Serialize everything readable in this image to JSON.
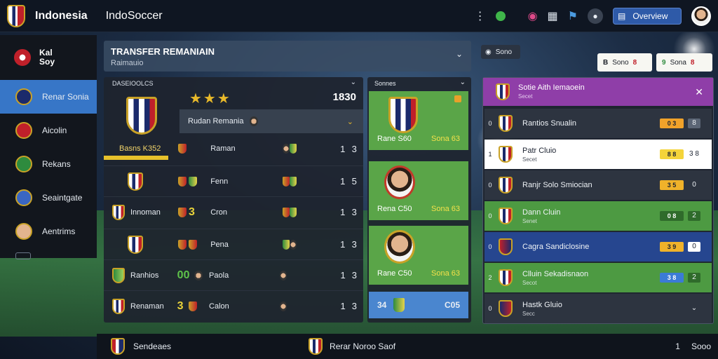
{
  "header": {
    "title": "Indonesia",
    "subtitle": "IndoSoccer",
    "button_label": "Overview"
  },
  "sidebar": {
    "head_label_1": "Kal",
    "head_label_2": "Soy",
    "items": [
      {
        "label": "Renar Sonia"
      },
      {
        "label": "Aicolin"
      },
      {
        "label": "Rekans"
      },
      {
        "label": "Seaintgate"
      },
      {
        "label": "Aentrims"
      }
    ]
  },
  "transfer": {
    "title": "TRANSFER REMANIAIN",
    "subtitle": "Raimauio"
  },
  "list_panel": {
    "header": "DASEIOOLCS",
    "stars": "★★★",
    "top_score": "1830",
    "club_name": "Basns K352",
    "highlight": {
      "name": "Rudan Remania"
    },
    "rows": [
      {
        "icons_lead": "",
        "name": "Raman",
        "n1": "1",
        "n2": "3"
      },
      {
        "icons_lead": "",
        "name": "Fenn",
        "n1": "1",
        "n2": "5"
      },
      {
        "lead": "Innoman",
        "hl": "3",
        "name": "Cron",
        "n1": "1",
        "n2": "3"
      },
      {
        "lead": "",
        "name": "Pena",
        "n1": "1",
        "n2": "3"
      },
      {
        "lead": "Ranhios",
        "hl": "00",
        "name": "Paola",
        "n1": "1",
        "n2": "3"
      },
      {
        "lead": "Renaman",
        "hl": "3",
        "name": "Calon",
        "n1": "1",
        "n2": "3"
      }
    ]
  },
  "cards": {
    "header": "Sonnes",
    "items": [
      {
        "left": "Rane S60",
        "right": "Sona 63"
      },
      {
        "left": "Rena C50",
        "right": "Sona 63"
      },
      {
        "left": "Rane C50",
        "right": "Sona 63"
      }
    ],
    "blue": {
      "left": "34",
      "right": "C05"
    }
  },
  "right_panel": {
    "toggle_label": "Sono",
    "btn1": {
      "icon": "B",
      "label": "Sono",
      "value": "8"
    },
    "btn2": {
      "icon": "9",
      "label": "Sona",
      "value": "8"
    },
    "header": {
      "title": "Sotie Aith Iemaoein",
      "sub": "Secet"
    },
    "rows": [
      {
        "idx": "0",
        "title": "Rantios Snualin",
        "sub": "",
        "sc": "0 3",
        "sc2": "8",
        "style": "dark",
        "scColor": "#f0a22a"
      },
      {
        "idx": "1",
        "title": "Patr Cluio",
        "sub": "Secet",
        "sc": "8 8",
        "sc2": "3 8",
        "style": "white",
        "scColor": "#f4d43a"
      },
      {
        "idx": "0",
        "title": "Ranjr Solo Smiocian",
        "sub": "",
        "sc": "3 5",
        "sc2": "0",
        "style": "dark",
        "scColor": "#f0b22a"
      },
      {
        "idx": "0",
        "title": "Dann Cluin",
        "sub": "Senet",
        "sc": "0 8",
        "sc2": "2",
        "style": "green",
        "scColor": "#2f6b2b"
      },
      {
        "idx": "0",
        "title": "Cagra Sandiclosine",
        "sub": "",
        "sc": "3 9",
        "sc2": "0",
        "style": "blue",
        "scColor": "#f0b22a"
      },
      {
        "idx": "2",
        "title": "Clluin Sekadisnaon",
        "sub": "Secot",
        "sc": "3 8",
        "sc2": "2",
        "style": "green",
        "scColor": "#3b7bd6"
      },
      {
        "idx": "0",
        "title": "Hastk Gluio",
        "sub": "Secc",
        "sc": "",
        "sc2": "",
        "style": "dark",
        "scColor": "#2d3440"
      }
    ]
  },
  "bottom": {
    "left_label": "Sendeaes",
    "center_label": "Rerar Noroo Saof",
    "num": "1",
    "right_label": "Sooo"
  },
  "colors": {
    "accent_blue": "#3776c7",
    "gold": "#e8b92a",
    "green": "#5aa548",
    "purple": "#8f3ea8"
  }
}
